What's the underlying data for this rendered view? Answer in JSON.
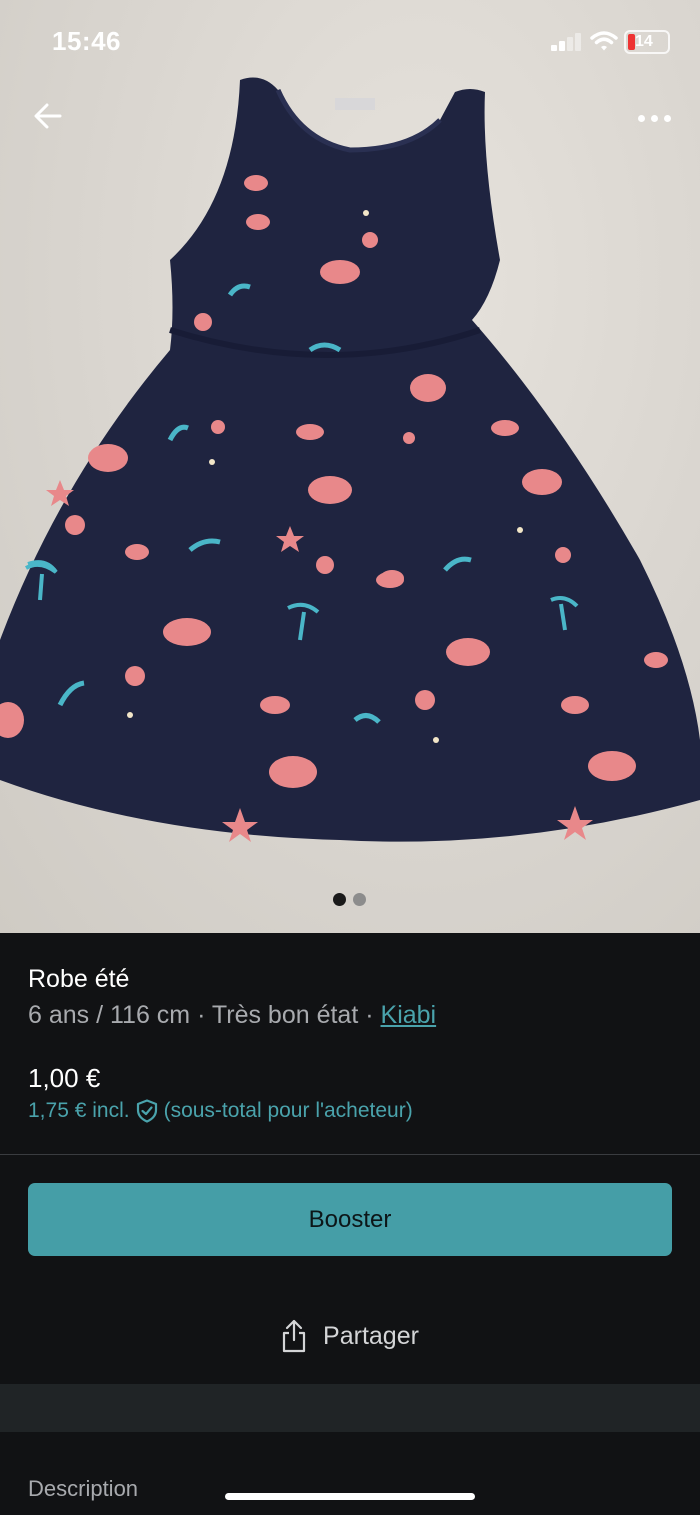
{
  "status_bar": {
    "time": "15:46",
    "battery": "14"
  },
  "photo": {
    "pager": {
      "count": 2,
      "active_index": 0
    }
  },
  "item": {
    "title": "Robe été",
    "size": "6 ans / 116 cm",
    "condition": "Très bon état",
    "separator": "·",
    "brand": "Kiabi",
    "price": "1,00 €",
    "price_incl": "1,75 € incl.",
    "price_note": "(sous-total pour l'acheteur)"
  },
  "actions": {
    "boost_label": "Booster",
    "share_label": "Partager"
  },
  "description": {
    "heading": "Description"
  },
  "colors": {
    "accent": "#459ea7",
    "link": "#4aa3ac",
    "background": "#111214",
    "dress": "#1f2440"
  }
}
